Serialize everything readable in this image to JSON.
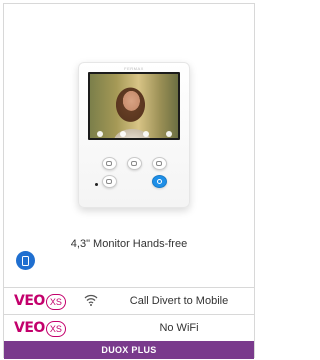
{
  "product": {
    "monitor_brand": "FERMAX",
    "caption": "4,3\" Monitor Hands-free",
    "icons": {
      "handsfree": "smartphone-icon",
      "wifi": "wifi-icon"
    }
  },
  "features": [
    {
      "logo_word": "VEO",
      "logo_badge": "XS",
      "label": "Call Divert to Mobile",
      "icon": "wifi-icon"
    },
    {
      "logo_word": "VEO",
      "logo_badge": "XS",
      "label": "No WiFi"
    }
  ],
  "footer": {
    "label": "DUOX PLUS"
  },
  "colors": {
    "accent": "#c3006c",
    "footer_bg": "#7a3a8c",
    "blue": "#1e8fe8"
  }
}
